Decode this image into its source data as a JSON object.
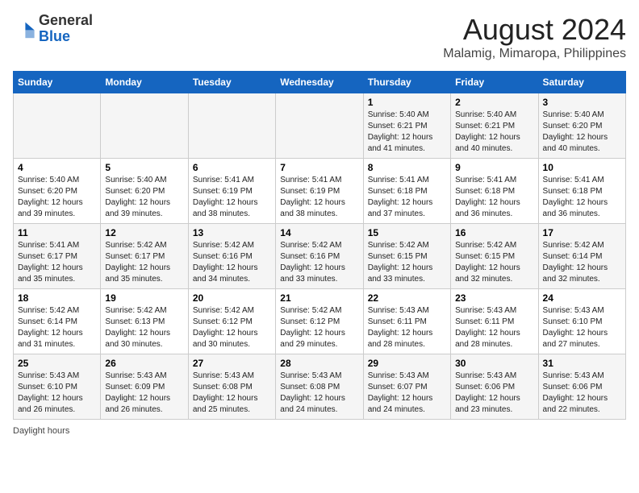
{
  "header": {
    "logo_line1": "General",
    "logo_line2": "Blue",
    "title": "August 2024",
    "subtitle": "Malamig, Mimaropa, Philippines"
  },
  "days_of_week": [
    "Sunday",
    "Monday",
    "Tuesday",
    "Wednesday",
    "Thursday",
    "Friday",
    "Saturday"
  ],
  "weeks": [
    [
      {
        "num": "",
        "detail": ""
      },
      {
        "num": "",
        "detail": ""
      },
      {
        "num": "",
        "detail": ""
      },
      {
        "num": "",
        "detail": ""
      },
      {
        "num": "1",
        "detail": "Sunrise: 5:40 AM\nSunset: 6:21 PM\nDaylight: 12 hours and 41 minutes."
      },
      {
        "num": "2",
        "detail": "Sunrise: 5:40 AM\nSunset: 6:21 PM\nDaylight: 12 hours and 40 minutes."
      },
      {
        "num": "3",
        "detail": "Sunrise: 5:40 AM\nSunset: 6:20 PM\nDaylight: 12 hours and 40 minutes."
      }
    ],
    [
      {
        "num": "4",
        "detail": "Sunrise: 5:40 AM\nSunset: 6:20 PM\nDaylight: 12 hours and 39 minutes."
      },
      {
        "num": "5",
        "detail": "Sunrise: 5:40 AM\nSunset: 6:20 PM\nDaylight: 12 hours and 39 minutes."
      },
      {
        "num": "6",
        "detail": "Sunrise: 5:41 AM\nSunset: 6:19 PM\nDaylight: 12 hours and 38 minutes."
      },
      {
        "num": "7",
        "detail": "Sunrise: 5:41 AM\nSunset: 6:19 PM\nDaylight: 12 hours and 38 minutes."
      },
      {
        "num": "8",
        "detail": "Sunrise: 5:41 AM\nSunset: 6:18 PM\nDaylight: 12 hours and 37 minutes."
      },
      {
        "num": "9",
        "detail": "Sunrise: 5:41 AM\nSunset: 6:18 PM\nDaylight: 12 hours and 36 minutes."
      },
      {
        "num": "10",
        "detail": "Sunrise: 5:41 AM\nSunset: 6:18 PM\nDaylight: 12 hours and 36 minutes."
      }
    ],
    [
      {
        "num": "11",
        "detail": "Sunrise: 5:41 AM\nSunset: 6:17 PM\nDaylight: 12 hours and 35 minutes."
      },
      {
        "num": "12",
        "detail": "Sunrise: 5:42 AM\nSunset: 6:17 PM\nDaylight: 12 hours and 35 minutes."
      },
      {
        "num": "13",
        "detail": "Sunrise: 5:42 AM\nSunset: 6:16 PM\nDaylight: 12 hours and 34 minutes."
      },
      {
        "num": "14",
        "detail": "Sunrise: 5:42 AM\nSunset: 6:16 PM\nDaylight: 12 hours and 33 minutes."
      },
      {
        "num": "15",
        "detail": "Sunrise: 5:42 AM\nSunset: 6:15 PM\nDaylight: 12 hours and 33 minutes."
      },
      {
        "num": "16",
        "detail": "Sunrise: 5:42 AM\nSunset: 6:15 PM\nDaylight: 12 hours and 32 minutes."
      },
      {
        "num": "17",
        "detail": "Sunrise: 5:42 AM\nSunset: 6:14 PM\nDaylight: 12 hours and 32 minutes."
      }
    ],
    [
      {
        "num": "18",
        "detail": "Sunrise: 5:42 AM\nSunset: 6:14 PM\nDaylight: 12 hours and 31 minutes."
      },
      {
        "num": "19",
        "detail": "Sunrise: 5:42 AM\nSunset: 6:13 PM\nDaylight: 12 hours and 30 minutes."
      },
      {
        "num": "20",
        "detail": "Sunrise: 5:42 AM\nSunset: 6:12 PM\nDaylight: 12 hours and 30 minutes."
      },
      {
        "num": "21",
        "detail": "Sunrise: 5:42 AM\nSunset: 6:12 PM\nDaylight: 12 hours and 29 minutes."
      },
      {
        "num": "22",
        "detail": "Sunrise: 5:43 AM\nSunset: 6:11 PM\nDaylight: 12 hours and 28 minutes."
      },
      {
        "num": "23",
        "detail": "Sunrise: 5:43 AM\nSunset: 6:11 PM\nDaylight: 12 hours and 28 minutes."
      },
      {
        "num": "24",
        "detail": "Sunrise: 5:43 AM\nSunset: 6:10 PM\nDaylight: 12 hours and 27 minutes."
      }
    ],
    [
      {
        "num": "25",
        "detail": "Sunrise: 5:43 AM\nSunset: 6:10 PM\nDaylight: 12 hours and 26 minutes."
      },
      {
        "num": "26",
        "detail": "Sunrise: 5:43 AM\nSunset: 6:09 PM\nDaylight: 12 hours and 26 minutes."
      },
      {
        "num": "27",
        "detail": "Sunrise: 5:43 AM\nSunset: 6:08 PM\nDaylight: 12 hours and 25 minutes."
      },
      {
        "num": "28",
        "detail": "Sunrise: 5:43 AM\nSunset: 6:08 PM\nDaylight: 12 hours and 24 minutes."
      },
      {
        "num": "29",
        "detail": "Sunrise: 5:43 AM\nSunset: 6:07 PM\nDaylight: 12 hours and 24 minutes."
      },
      {
        "num": "30",
        "detail": "Sunrise: 5:43 AM\nSunset: 6:06 PM\nDaylight: 12 hours and 23 minutes."
      },
      {
        "num": "31",
        "detail": "Sunrise: 5:43 AM\nSunset: 6:06 PM\nDaylight: 12 hours and 22 minutes."
      }
    ]
  ],
  "footer": "Daylight hours"
}
